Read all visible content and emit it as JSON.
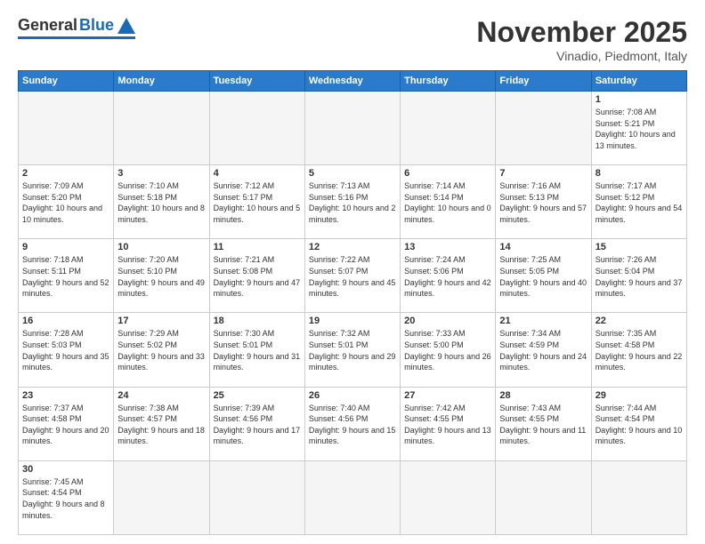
{
  "header": {
    "logo_general": "General",
    "logo_blue": "Blue",
    "month_title": "November 2025",
    "location": "Vinadio, Piedmont, Italy"
  },
  "weekdays": [
    "Sunday",
    "Monday",
    "Tuesday",
    "Wednesday",
    "Thursday",
    "Friday",
    "Saturday"
  ],
  "weeks": [
    [
      {
        "day": "",
        "info": ""
      },
      {
        "day": "",
        "info": ""
      },
      {
        "day": "",
        "info": ""
      },
      {
        "day": "",
        "info": ""
      },
      {
        "day": "",
        "info": ""
      },
      {
        "day": "",
        "info": ""
      },
      {
        "day": "1",
        "info": "Sunrise: 7:08 AM\nSunset: 5:21 PM\nDaylight: 10 hours\nand 13 minutes."
      }
    ],
    [
      {
        "day": "2",
        "info": "Sunrise: 7:09 AM\nSunset: 5:20 PM\nDaylight: 10 hours\nand 10 minutes."
      },
      {
        "day": "3",
        "info": "Sunrise: 7:10 AM\nSunset: 5:18 PM\nDaylight: 10 hours\nand 8 minutes."
      },
      {
        "day": "4",
        "info": "Sunrise: 7:12 AM\nSunset: 5:17 PM\nDaylight: 10 hours\nand 5 minutes."
      },
      {
        "day": "5",
        "info": "Sunrise: 7:13 AM\nSunset: 5:16 PM\nDaylight: 10 hours\nand 2 minutes."
      },
      {
        "day": "6",
        "info": "Sunrise: 7:14 AM\nSunset: 5:14 PM\nDaylight: 10 hours\nand 0 minutes."
      },
      {
        "day": "7",
        "info": "Sunrise: 7:16 AM\nSunset: 5:13 PM\nDaylight: 9 hours\nand 57 minutes."
      },
      {
        "day": "8",
        "info": "Sunrise: 7:17 AM\nSunset: 5:12 PM\nDaylight: 9 hours\nand 54 minutes."
      }
    ],
    [
      {
        "day": "9",
        "info": "Sunrise: 7:18 AM\nSunset: 5:11 PM\nDaylight: 9 hours\nand 52 minutes."
      },
      {
        "day": "10",
        "info": "Sunrise: 7:20 AM\nSunset: 5:10 PM\nDaylight: 9 hours\nand 49 minutes."
      },
      {
        "day": "11",
        "info": "Sunrise: 7:21 AM\nSunset: 5:08 PM\nDaylight: 9 hours\nand 47 minutes."
      },
      {
        "day": "12",
        "info": "Sunrise: 7:22 AM\nSunset: 5:07 PM\nDaylight: 9 hours\nand 45 minutes."
      },
      {
        "day": "13",
        "info": "Sunrise: 7:24 AM\nSunset: 5:06 PM\nDaylight: 9 hours\nand 42 minutes."
      },
      {
        "day": "14",
        "info": "Sunrise: 7:25 AM\nSunset: 5:05 PM\nDaylight: 9 hours\nand 40 minutes."
      },
      {
        "day": "15",
        "info": "Sunrise: 7:26 AM\nSunset: 5:04 PM\nDaylight: 9 hours\nand 37 minutes."
      }
    ],
    [
      {
        "day": "16",
        "info": "Sunrise: 7:28 AM\nSunset: 5:03 PM\nDaylight: 9 hours\nand 35 minutes."
      },
      {
        "day": "17",
        "info": "Sunrise: 7:29 AM\nSunset: 5:02 PM\nDaylight: 9 hours\nand 33 minutes."
      },
      {
        "day": "18",
        "info": "Sunrise: 7:30 AM\nSunset: 5:01 PM\nDaylight: 9 hours\nand 31 minutes."
      },
      {
        "day": "19",
        "info": "Sunrise: 7:32 AM\nSunset: 5:01 PM\nDaylight: 9 hours\nand 29 minutes."
      },
      {
        "day": "20",
        "info": "Sunrise: 7:33 AM\nSunset: 5:00 PM\nDaylight: 9 hours\nand 26 minutes."
      },
      {
        "day": "21",
        "info": "Sunrise: 7:34 AM\nSunset: 4:59 PM\nDaylight: 9 hours\nand 24 minutes."
      },
      {
        "day": "22",
        "info": "Sunrise: 7:35 AM\nSunset: 4:58 PM\nDaylight: 9 hours\nand 22 minutes."
      }
    ],
    [
      {
        "day": "23",
        "info": "Sunrise: 7:37 AM\nSunset: 4:58 PM\nDaylight: 9 hours\nand 20 minutes."
      },
      {
        "day": "24",
        "info": "Sunrise: 7:38 AM\nSunset: 4:57 PM\nDaylight: 9 hours\nand 18 minutes."
      },
      {
        "day": "25",
        "info": "Sunrise: 7:39 AM\nSunset: 4:56 PM\nDaylight: 9 hours\nand 17 minutes."
      },
      {
        "day": "26",
        "info": "Sunrise: 7:40 AM\nSunset: 4:56 PM\nDaylight: 9 hours\nand 15 minutes."
      },
      {
        "day": "27",
        "info": "Sunrise: 7:42 AM\nSunset: 4:55 PM\nDaylight: 9 hours\nand 13 minutes."
      },
      {
        "day": "28",
        "info": "Sunrise: 7:43 AM\nSunset: 4:55 PM\nDaylight: 9 hours\nand 11 minutes."
      },
      {
        "day": "29",
        "info": "Sunrise: 7:44 AM\nSunset: 4:54 PM\nDaylight: 9 hours\nand 10 minutes."
      }
    ],
    [
      {
        "day": "30",
        "info": "Sunrise: 7:45 AM\nSunset: 4:54 PM\nDaylight: 9 hours\nand 8 minutes."
      },
      {
        "day": "",
        "info": ""
      },
      {
        "day": "",
        "info": ""
      },
      {
        "day": "",
        "info": ""
      },
      {
        "day": "",
        "info": ""
      },
      {
        "day": "",
        "info": ""
      },
      {
        "day": "",
        "info": ""
      }
    ]
  ]
}
